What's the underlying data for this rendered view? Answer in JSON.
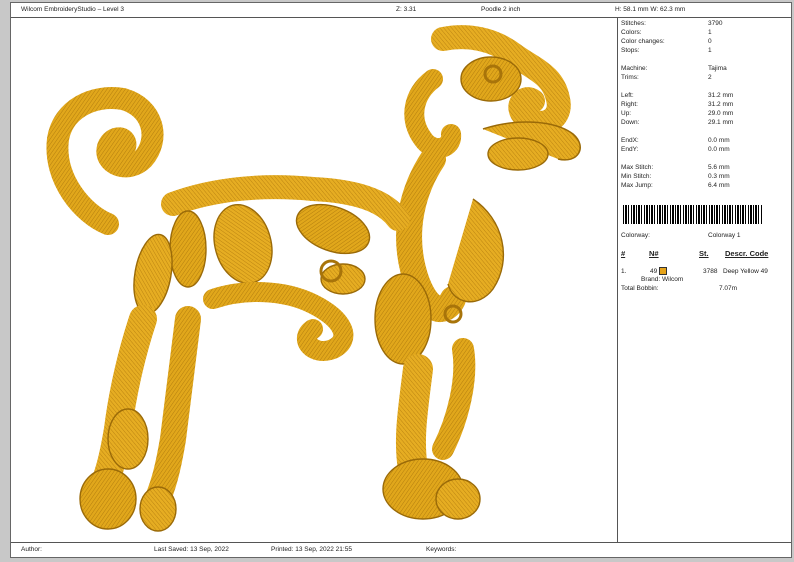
{
  "header": {
    "app_title": "Wilcom EmbroideryStudio – Level 3",
    "zoom": "Z: 3.31",
    "design_name": "Poodle 2 inch",
    "dimensions": "H: 58.1 mm   W: 62.3 mm"
  },
  "stats": [
    {
      "label": "Stitches:",
      "value": "3790"
    },
    {
      "label": "Colors:",
      "value": "1"
    },
    {
      "label": "Color changes:",
      "value": "0"
    },
    {
      "label": "Stops:",
      "value": "1"
    },
    {
      "label": "Machine:",
      "value": "Tajima"
    },
    {
      "label": "Trims:",
      "value": "2"
    },
    {
      "label": "Left:",
      "value": "31.2 mm"
    },
    {
      "label": "Right:",
      "value": "31.2 mm"
    },
    {
      "label": "Up:",
      "value": "29.0 mm"
    },
    {
      "label": "Down:",
      "value": "29.1 mm"
    },
    {
      "label": "EndX:",
      "value": "0.0 mm"
    },
    {
      "label": "EndY:",
      "value": "0.0 mm"
    },
    {
      "label": "Max Stitch:",
      "value": "5.6 mm"
    },
    {
      "label": "Min Stitch:",
      "value": "0.3 mm"
    },
    {
      "label": "Max Jump:",
      "value": "6.4 mm"
    }
  ],
  "colorway": {
    "label": "Colorway:",
    "value": "Colorway 1"
  },
  "table": {
    "headers": [
      "#",
      "N#",
      "St.",
      "Descr. Code"
    ],
    "rows": [
      {
        "index": "1.",
        "n": "49",
        "stitches": "3788",
        "desc": "Deep Yellow 49",
        "brand": "Brand: Wilcom",
        "swatch_color": "#e5a31a"
      }
    ]
  },
  "bobbin": {
    "label": "Total Bobbin:",
    "value": "7.07m"
  },
  "footer": {
    "author": "Author:",
    "last_saved": "Last Saved: 13 Sep, 2022",
    "printed": "Printed: 13 Sep, 2022 21:55",
    "keywords": "Keywords:"
  },
  "colors": {
    "thread": "#e1a71b",
    "thread_dark": "#a8740a",
    "thread_light": "#f6cf4c"
  }
}
